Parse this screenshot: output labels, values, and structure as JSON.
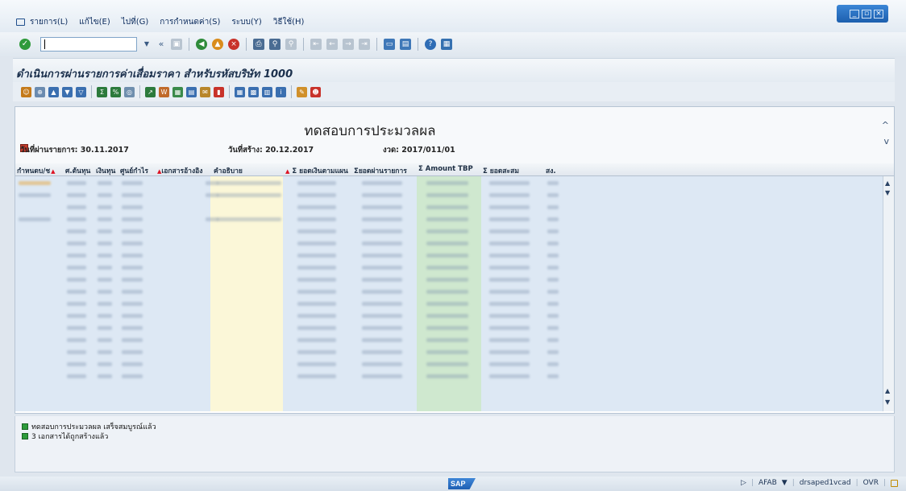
{
  "menu": {
    "items": [
      "รายการ(L)",
      "แก้ไข(E)",
      "ไปที่(G)",
      "การกำหนดค่า(S)",
      "ระบบ(Y)",
      "วิธีใช้(H)"
    ]
  },
  "toolbar": {
    "command_value": ""
  },
  "page": {
    "title": "ดำเนินการผ่านรายการค่าเสื่อมราคา สำหรับรหัสบริษัท 1000"
  },
  "report": {
    "title": "ทดสอบการประมวลผล",
    "posting_date": "วันที่ผ่านรายการ: 30.11.2017",
    "created_date": "วันที่สร้าง: 20.12.2017",
    "period": "งวด: 2017/011/01"
  },
  "grid": {
    "columns": [
      "กำหนดบ/ช",
      "ศ.ต้นทุน",
      "เงินทุน",
      "ศูนย์กำไร",
      "เอกสารอ้างอิง",
      "คำอธิบาย",
      "ยอดเงินตามแผน",
      "ยอดผ่านรายการ",
      "Amount TBP",
      "ยอดสะสม",
      "สง."
    ]
  },
  "messages": [
    "ทดสอบการประมวลผล เสร็จสมบูรณ์แล้ว",
    "3 เอกสารได้ถูกสร้างแล้ว"
  ],
  "status": {
    "transaction": "AFAB",
    "server": "drsaped1vcad",
    "mode": "OVR"
  },
  "colors": {
    "accent": "#1d5fae",
    "success": "#2d9b3b",
    "highlight_yellow": "#fbf7d8",
    "highlight_green": "#cfe8cf"
  }
}
